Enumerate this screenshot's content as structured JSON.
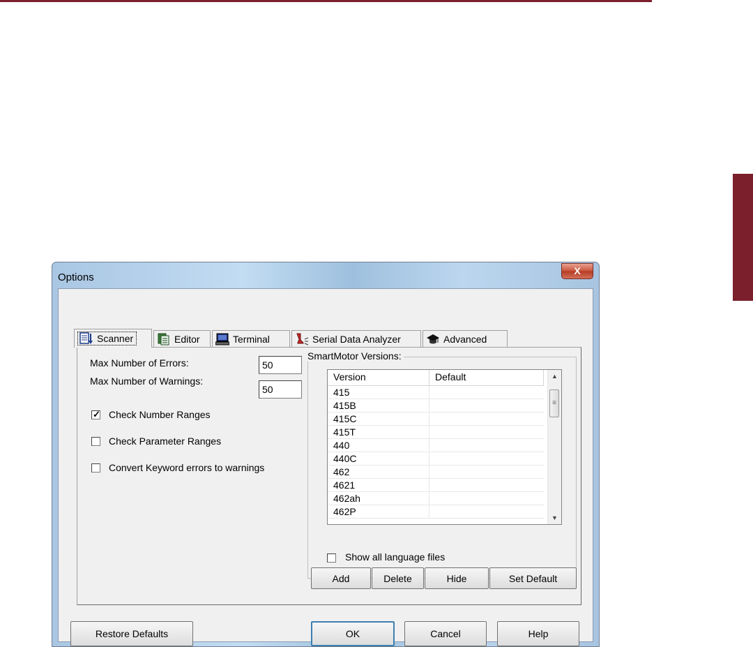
{
  "window": {
    "title": "Options",
    "close_glyph": "X"
  },
  "tabs": [
    {
      "label": "Scanner",
      "icon": "scanner-icon",
      "active": true
    },
    {
      "label": "Editor",
      "icon": "editor-icon"
    },
    {
      "label": "Terminal",
      "icon": "terminal-icon"
    },
    {
      "label": "Serial Data Analyzer",
      "icon": "serial-data-analyzer-icon"
    },
    {
      "label": "Advanced",
      "icon": "advanced-icon"
    }
  ],
  "scanner": {
    "max_errors_label": "Max Number of Errors:",
    "max_errors_value": "50",
    "max_warnings_label": "Max Number of Warnings:",
    "max_warnings_value": "50",
    "check_number_ranges": {
      "label": "Check Number Ranges",
      "checked": true
    },
    "check_parameter_ranges": {
      "label": "Check Parameter Ranges",
      "checked": false
    },
    "convert_keyword_errors": {
      "label": "Convert Keyword errors to warnings",
      "checked": false
    }
  },
  "versions": {
    "group_label": "SmartMotor Versions:",
    "columns": [
      "Version",
      "Default"
    ],
    "rows": [
      "415",
      "415B",
      "415C",
      "415T",
      "440",
      "440C",
      "462",
      "4621",
      "462ah",
      "462P"
    ],
    "show_all": {
      "label": "Show all language files",
      "checked": false
    },
    "buttons": {
      "add": "Add",
      "delete": "Delete",
      "hide": "Hide",
      "set_default": "Set Default"
    }
  },
  "footer": {
    "restore_defaults": "Restore Defaults",
    "ok": "OK",
    "cancel": "Cancel",
    "help": "Help"
  },
  "colors": {
    "accent": "#7a1f2b",
    "focus_border": "#3c7fb1"
  }
}
